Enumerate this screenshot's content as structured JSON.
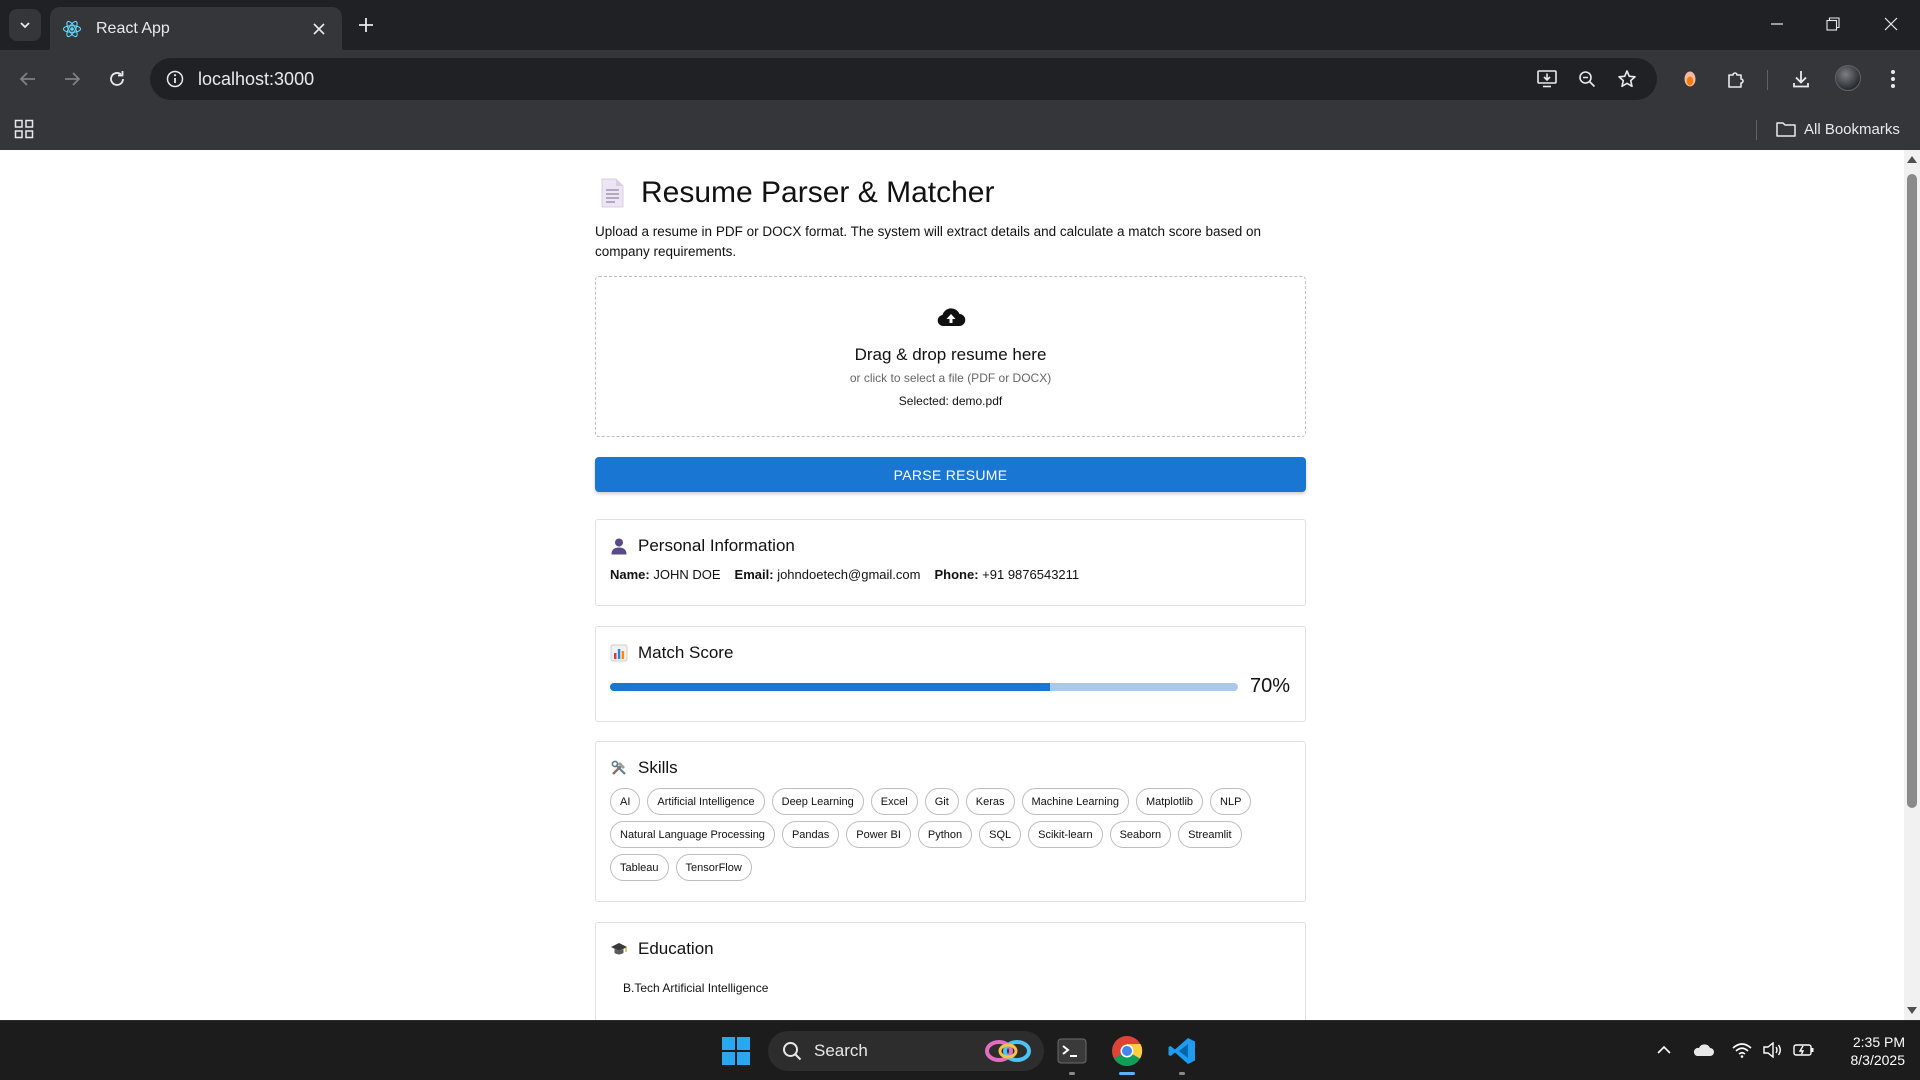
{
  "browser": {
    "tab_title": "React App",
    "url": "localhost:3000",
    "bookmarks_label": "All Bookmarks"
  },
  "page": {
    "title": "Resume Parser & Matcher",
    "intro": "Upload a resume in PDF or DOCX format. The system will extract details and calculate a match score based on company requirements.",
    "dropzone": {
      "main": "Drag & drop resume here",
      "sub": "or click to select a file (PDF or DOCX)",
      "selected": "Selected: demo.pdf"
    },
    "parse_button": "PARSE RESUME",
    "personal": {
      "title": "Personal Information",
      "name_label": "Name:",
      "name": "JOHN DOE",
      "email_label": "Email:",
      "email": "johndoetech@gmail.com",
      "phone_label": "Phone:",
      "phone": "+91 9876543211"
    },
    "match": {
      "title": "Match Score",
      "score_label": "70%",
      "score_fraction": 0.7
    },
    "skills": {
      "title": "Skills",
      "items": [
        "AI",
        "Artificial Intelligence",
        "Deep Learning",
        "Excel",
        "Git",
        "Keras",
        "Machine Learning",
        "Matplotlib",
        "NLP",
        "Natural Language Processing",
        "Pandas",
        "Power BI",
        "Python",
        "SQL",
        "Scikit-learn",
        "Seaborn",
        "Streamlit",
        "Tableau",
        "TensorFlow"
      ]
    },
    "education": {
      "title": "Education",
      "items": [
        "B.Tech Artificial Intelligence"
      ]
    }
  },
  "taskbar": {
    "search_label": "Search",
    "time": "2:35 PM",
    "date": "8/3/2025"
  },
  "colors": {
    "primary": "#1976d2",
    "progress_track": "#a9c8ee"
  }
}
